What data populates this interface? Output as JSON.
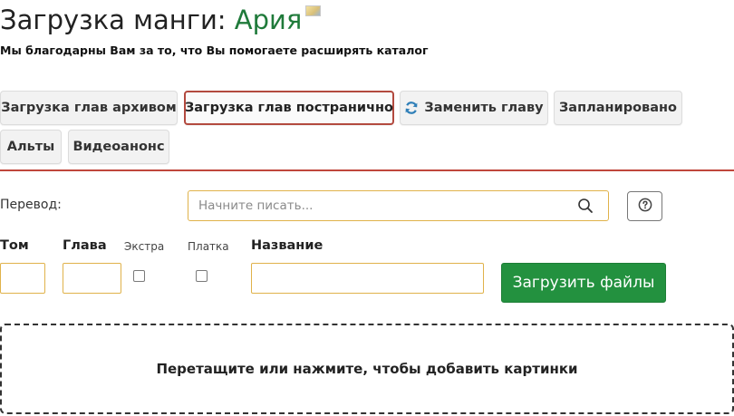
{
  "header": {
    "title_prefix": "Загрузка манги: ",
    "manga_name": "Ария",
    "subtitle": "Мы благодарны Вам за то, что Вы помогаете расширять каталог"
  },
  "tabs": [
    {
      "label": "Загрузка глав архивом",
      "active": false
    },
    {
      "label": "Загрузка глав постранично",
      "active": true
    },
    {
      "label": "Заменить главу",
      "icon": "refresh-icon",
      "active": false
    },
    {
      "label": "Запланировано",
      "active": false
    },
    {
      "label": "Альты",
      "active": false
    },
    {
      "label": "Видеоанонс",
      "active": false
    }
  ],
  "translation": {
    "label": "Перевод:",
    "placeholder": "Начните писать...",
    "value": ""
  },
  "chapter_form": {
    "volume_label": "Том",
    "volume_value": "",
    "chapter_label": "Глава",
    "chapter_value": "",
    "extra_label": "Экстра",
    "extra_checked": false,
    "paid_label": "Платка",
    "paid_checked": false,
    "name_label": "Название",
    "name_value": "",
    "upload_button": "Загрузить файлы"
  },
  "dropzone": {
    "text": "Перетащите или нажмите, чтобы добавить картинки"
  },
  "colors": {
    "accent_green": "#23913f",
    "manga_name_green": "#1f7a3a",
    "active_tab_border": "#b34a3f",
    "divider_red": "#c0473c",
    "input_border": "#e0b24a",
    "refresh_icon_blue": "#2f7fb8"
  }
}
